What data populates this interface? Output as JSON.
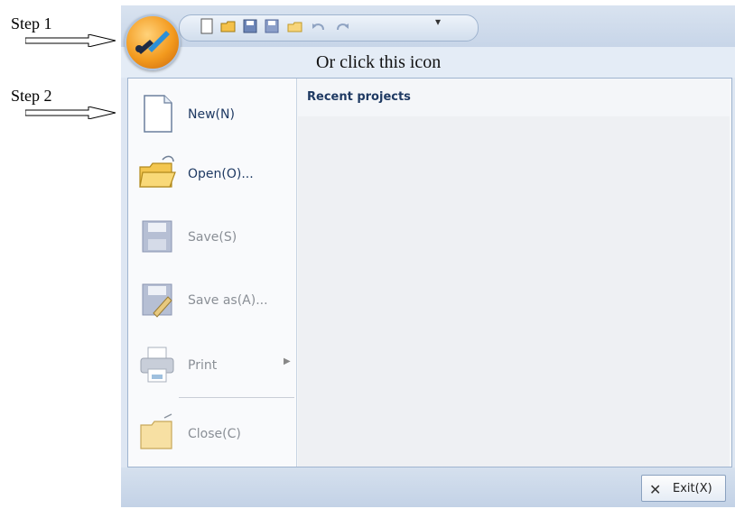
{
  "annotations": {
    "step1": "Step 1",
    "step2": "Step 2",
    "orb_hint": "Or click this icon"
  },
  "menu": {
    "items": [
      {
        "label": "New(N)",
        "enabled": true,
        "icon": "new-document-icon"
      },
      {
        "label": "Open(O)...",
        "enabled": true,
        "icon": "open-folder-icon"
      },
      {
        "label": "Save(S)",
        "enabled": false,
        "icon": "floppy-disk-icon"
      },
      {
        "label": "Save as(A)...",
        "enabled": false,
        "icon": "save-as-icon"
      },
      {
        "label": "Print",
        "enabled": false,
        "icon": "printer-icon"
      },
      {
        "label": "Close(C)",
        "enabled": false,
        "icon": "close-folder-icon"
      }
    ],
    "recent_title": "Recent projects"
  },
  "footer": {
    "exit_label": "Exit(X)"
  },
  "colors": {
    "accent_orange": "#f39a1e",
    "menu_text": "#1f3a63"
  }
}
